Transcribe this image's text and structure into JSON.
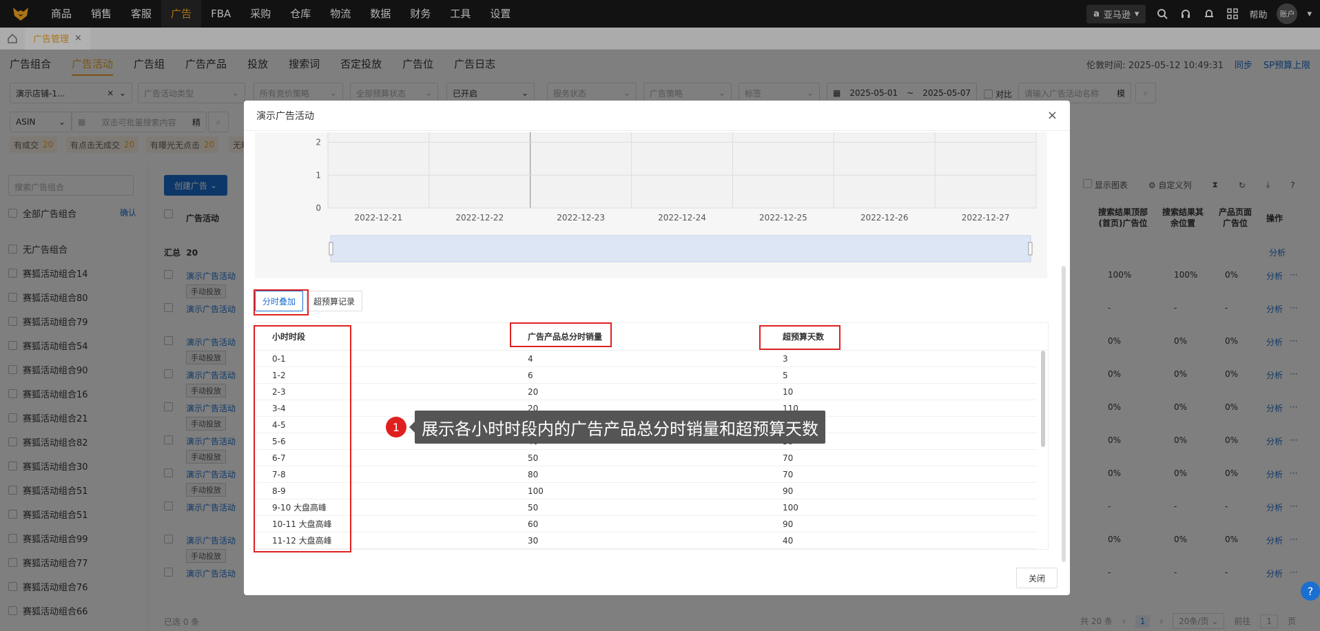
{
  "topnav": {
    "items": [
      "商品",
      "销售",
      "客服",
      "广告",
      "FBA",
      "采购",
      "仓库",
      "物流",
      "数据",
      "财务",
      "工具",
      "设置"
    ],
    "active": "广告",
    "region": "亚马逊",
    "help": "帮助",
    "account": "账户"
  },
  "tabs": {
    "page_tab": "广告管理"
  },
  "subnav": {
    "items": [
      "广告组合",
      "广告活动",
      "广告组",
      "广告产品",
      "投放",
      "搜索词",
      "否定投放",
      "广告位",
      "广告日志"
    ],
    "active": "广告活动",
    "time": "伦敦时间: 2025-05-12 10:49:31",
    "sync": "同步",
    "sp_budget": "SP预算上限"
  },
  "filters": {
    "store": "演示店铺-1...",
    "ad_type": "广告活动类型",
    "bid_strategy": "所有竞价策略",
    "budget_status": "全部预算状态",
    "enabled": "已开启",
    "service_status": "服务状态",
    "ad_strategy": "广告策略",
    "tag": "标签",
    "date_start": "2025-05-01",
    "date_sep": "~",
    "date_end": "2025-05-07",
    "compare": "对比",
    "name_placeholder": "请输入广告活动名称",
    "fuzzy": "模",
    "asin": "ASIN",
    "batch_placeholder": "双击可批量搜索内容",
    "exact": "精",
    "chips": [
      {
        "label": "有成交",
        "count": "20"
      },
      {
        "label": "有点击无成交",
        "count": "20"
      },
      {
        "label": "有曝光无点击",
        "count": "20"
      },
      {
        "label": "无曝",
        "count": ""
      }
    ]
  },
  "left": {
    "search_placeholder": "搜索广告组合",
    "all_label": "全部广告组合",
    "confirm": "确认",
    "items": [
      "无广告组合",
      "赛狐活动组合14",
      "赛狐活动组合80",
      "赛狐活动组合79",
      "赛狐活动组合54",
      "赛狐活动组合90",
      "赛狐活动组合16",
      "赛狐活动组合21",
      "赛狐活动组合82",
      "赛狐活动组合30",
      "赛狐活动组合51",
      "赛狐活动组合51",
      "赛狐活动组合99",
      "赛狐活动组合77",
      "赛狐活动组合76",
      "赛狐活动组合66"
    ]
  },
  "main": {
    "create": "创建广告",
    "col_campaign": "广告活动",
    "summary": "汇总",
    "summary_count": "20",
    "show_chart": "显示图表",
    "custom_cols": "自定义列",
    "col_top": "搜索结果顶部(首页)广告位",
    "col_rest": "搜索结果其余位置",
    "col_page": "产品页面广告位",
    "col_op": "操作",
    "analyze": "分析",
    "more": "···",
    "campaign_name": "演示广告活动",
    "manual": "手动投放",
    "rows": [
      {
        "manual": true,
        "top": "100%",
        "rest": "100%",
        "page": "0%"
      },
      {
        "manual": false,
        "top": "-",
        "rest": "-",
        "page": "-"
      },
      {
        "manual": true,
        "top": "0%",
        "rest": "0%",
        "page": "0%"
      },
      {
        "manual": true,
        "top": "0%",
        "rest": "0%",
        "page": "0%"
      },
      {
        "manual": true,
        "top": "0%",
        "rest": "0%",
        "page": "0%"
      },
      {
        "manual": true,
        "top": "0%",
        "rest": "0%",
        "page": "0%"
      },
      {
        "manual": true,
        "top": "0%",
        "rest": "0%",
        "page": "0%"
      },
      {
        "manual": false,
        "top": "-",
        "rest": "-",
        "page": "-"
      },
      {
        "manual": true,
        "top": "0%",
        "rest": "0%",
        "page": "0%"
      },
      {
        "manual": false,
        "top": "-",
        "rest": "-",
        "page": "-"
      }
    ]
  },
  "footer": {
    "selected": "已选 0 条",
    "total": "共 20 条",
    "page": "1",
    "per_page": "20条/页",
    "goto": "前往",
    "goto_page": "1",
    "page_unit": "页"
  },
  "modal": {
    "title": "演示广告活动",
    "tab_active": "分时叠加",
    "tab_other": "超预算记录",
    "col1": "小时时段",
    "col2": "广告产品总分时销量",
    "col3": "超预算天数",
    "close": "关闭",
    "rows": [
      {
        "hour": "0-1",
        "sales": "4",
        "days": "3"
      },
      {
        "hour": "1-2",
        "sales": "6",
        "days": "5"
      },
      {
        "hour": "2-3",
        "sales": "20",
        "days": "10"
      },
      {
        "hour": "3-4",
        "sales": "20",
        "days": "110"
      },
      {
        "hour": "4-5",
        "sales": "",
        "days": ""
      },
      {
        "hour": "5-6",
        "sales": "40",
        "days": "50"
      },
      {
        "hour": "6-7",
        "sales": "50",
        "days": "70"
      },
      {
        "hour": "7-8",
        "sales": "80",
        "days": "70"
      },
      {
        "hour": "8-9",
        "sales": "100",
        "days": "90"
      },
      {
        "hour": "9-10 大盘高峰",
        "sales": "50",
        "days": "100"
      },
      {
        "hour": "10-11 大盘高峰",
        "sales": "60",
        "days": "90"
      },
      {
        "hour": "11-12 大盘高峰",
        "sales": "30",
        "days": "40"
      }
    ]
  },
  "chart_data": {
    "type": "line",
    "x": [
      "2022-12-21",
      "2022-12-22",
      "2022-12-23",
      "2022-12-24",
      "2022-12-25",
      "2022-12-26",
      "2022-12-27"
    ],
    "y_ticks": [
      "0",
      "1",
      "2"
    ],
    "ylim": [
      0,
      2
    ]
  },
  "callout": {
    "number": "1",
    "text": "展示各小时时段内的广告产品总分时销量和超预算天数"
  },
  "colors": {
    "accent": "#f5a623",
    "primary": "#1a6fd0",
    "highlight": "#e02020"
  }
}
